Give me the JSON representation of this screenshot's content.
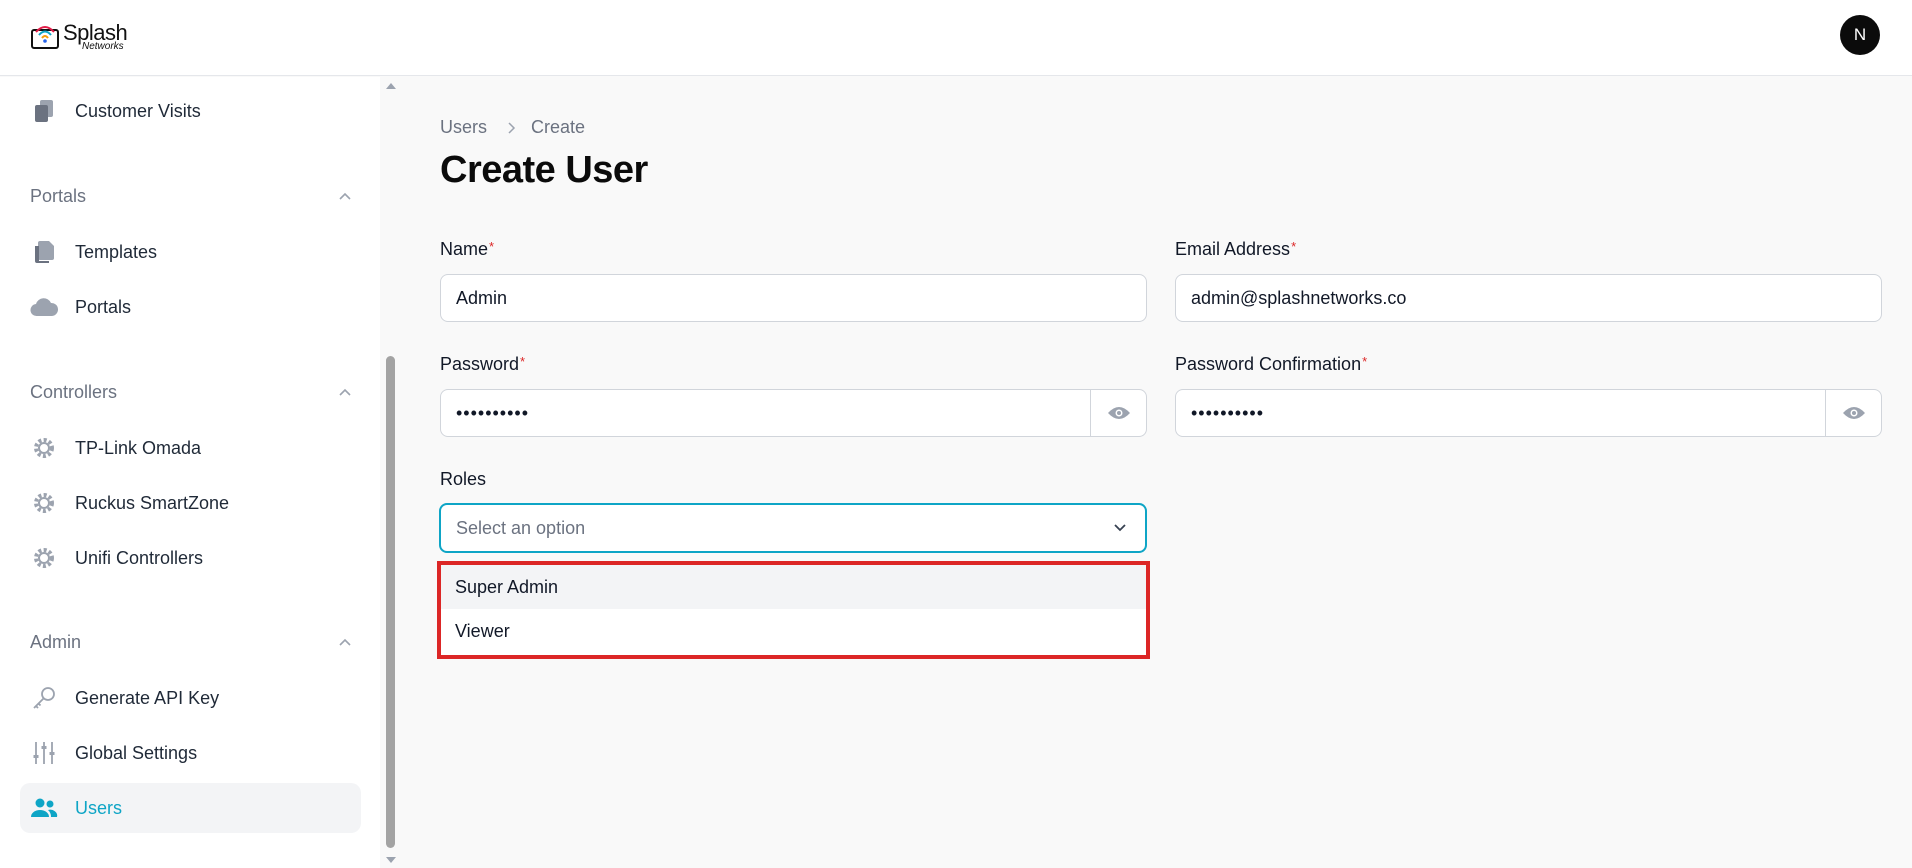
{
  "header": {
    "logo_text": "Splash",
    "logo_subtext": "Networks",
    "avatar_initial": "N"
  },
  "sidebar": {
    "top_item": {
      "label": "Customer Visits",
      "icon": "document-stack-icon"
    },
    "groups": [
      {
        "title": "Portals",
        "items": [
          {
            "label": "Templates",
            "icon": "documents-icon"
          },
          {
            "label": "Portals",
            "icon": "cloud-icon"
          }
        ]
      },
      {
        "title": "Controllers",
        "items": [
          {
            "label": "TP-Link Omada",
            "icon": "gear-icon"
          },
          {
            "label": "Ruckus SmartZone",
            "icon": "gear-icon"
          },
          {
            "label": "Unifi Controllers",
            "icon": "gear-icon"
          }
        ]
      },
      {
        "title": "Admin",
        "items": [
          {
            "label": "Generate API Key",
            "icon": "key-icon"
          },
          {
            "label": "Global Settings",
            "icon": "sliders-icon"
          },
          {
            "label": "Users",
            "icon": "users-icon",
            "active": true
          }
        ]
      }
    ]
  },
  "main": {
    "breadcrumb": [
      "Users",
      "Create"
    ],
    "title": "Create User",
    "form": {
      "name": {
        "label": "Name",
        "required_mark": "*",
        "value": "Admin"
      },
      "email": {
        "label": "Email Address",
        "required_mark": "*",
        "value": "admin@splashnetworks.co"
      },
      "password": {
        "label": "Password",
        "required_mark": "*",
        "value": "••••••••••"
      },
      "password_confirmation": {
        "label": "Password Confirmation",
        "required_mark": "*",
        "value": "••••••••••"
      },
      "roles": {
        "label": "Roles",
        "placeholder": "Select an option",
        "options": [
          "Super Admin",
          "Viewer"
        ]
      }
    }
  },
  "colors": {
    "accent": "#0ea5c6",
    "highlight_border": "#dc2626",
    "required": "#dc2626"
  }
}
